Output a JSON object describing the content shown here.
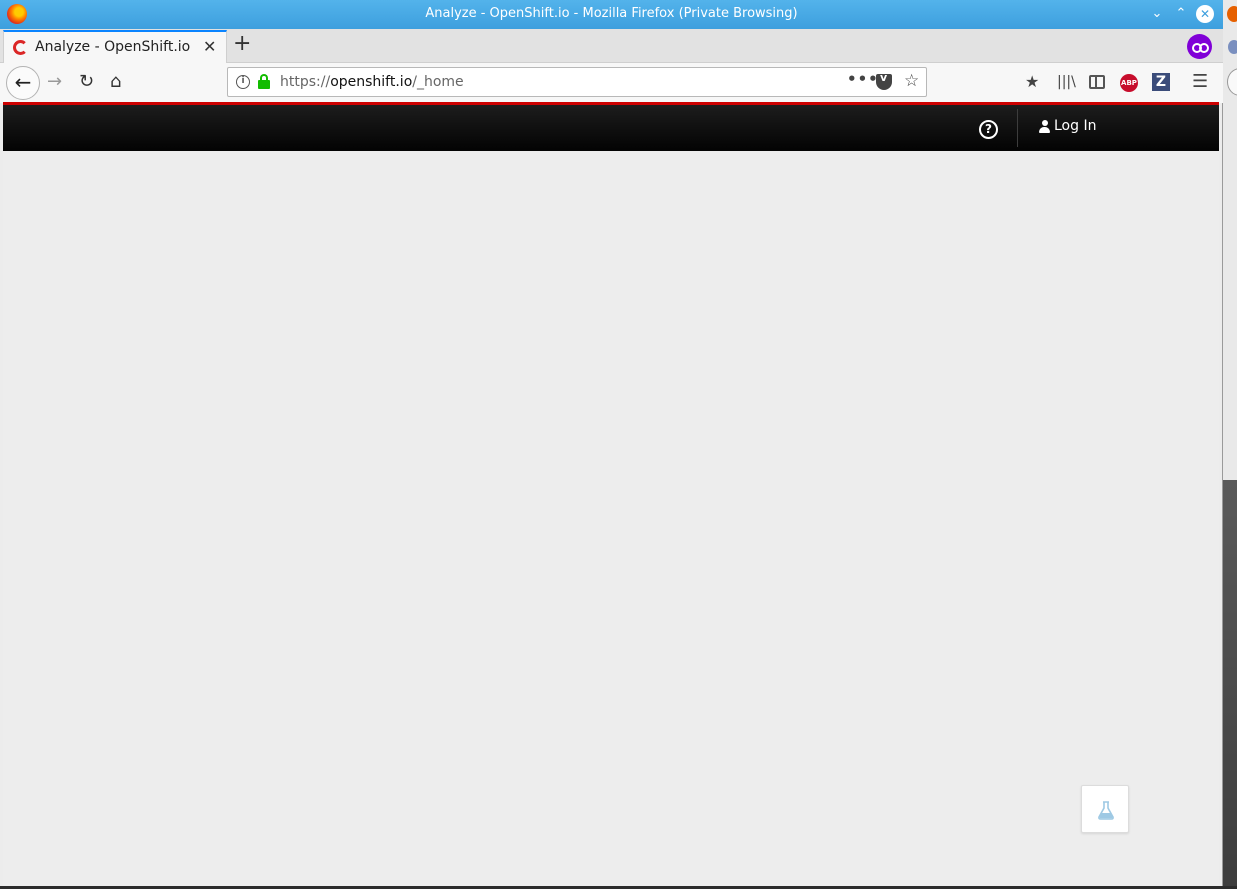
{
  "window": {
    "title": "Analyze - OpenShift.io - Mozilla Firefox (Private Browsing)"
  },
  "tabs": [
    {
      "label": "Analyze - OpenShift.io",
      "active": true
    }
  ],
  "toolbar": {
    "url_scheme": "https://",
    "url_host": "openshift.io",
    "url_path": "/_home",
    "abp_label": "ABP",
    "z_label": "Z"
  },
  "header": {
    "help_glyph": "?",
    "login_label": "Log In"
  },
  "icons": {
    "firefox": "firefox-logo-icon",
    "private": "private-browsing-mask-icon",
    "help": "help-icon",
    "user": "user-icon",
    "flask": "flask-icon"
  },
  "colors": {
    "titlebar": "#3d9fde",
    "header_accent": "#cc0000",
    "header_bg": "#030303",
    "page_bg": "#ededed",
    "lock": "#12bc00",
    "private": "#8000d7"
  }
}
